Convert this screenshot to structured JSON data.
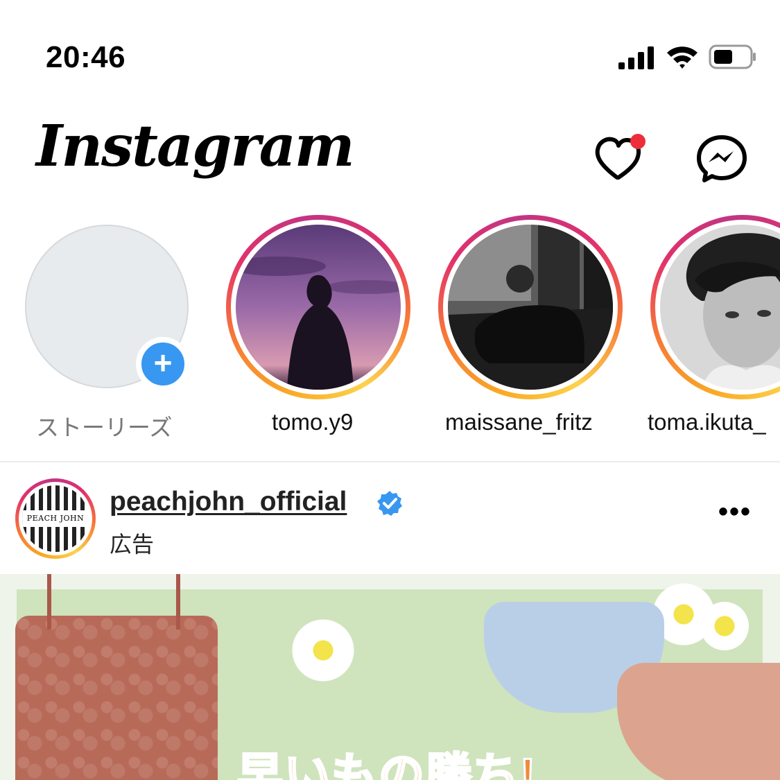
{
  "status_bar": {
    "time": "20:46"
  },
  "header": {
    "logo": "Instagram",
    "notification_dot_color": "#ed2d39"
  },
  "stories": [
    {
      "label": "ストーリーズ",
      "own": true
    },
    {
      "label": "tomo.y9"
    },
    {
      "label": "maissane_fritz"
    },
    {
      "label": "toma.ikuta_"
    }
  ],
  "post": {
    "username": "peachjohn_official",
    "verified": true,
    "sponsored_label": "広告",
    "avatar_text": "PEACH JOHN",
    "more_label": "•••",
    "ad_headline": "早いもの勝ち!"
  },
  "colors": {
    "accent_blue": "#3897f0",
    "verified_blue": "#3897f0"
  }
}
